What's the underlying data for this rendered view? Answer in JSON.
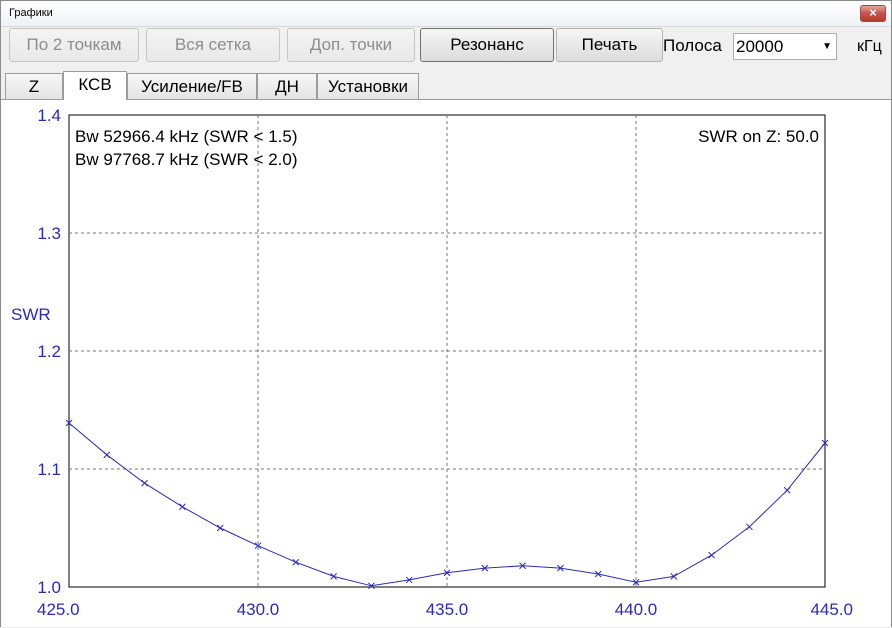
{
  "window": {
    "title": "Графики",
    "close_icon": "×"
  },
  "toolbar": {
    "by2points": "По 2 точкам",
    "whole_grid": "Вся сетка",
    "extra_points": "Доп. точки",
    "resonance": "Резонанс",
    "print": "Печать",
    "band_label": "Полоса",
    "band_value": "20000",
    "band_unit": "кГц"
  },
  "tabs": [
    "Z",
    "КСВ",
    "Усиление/FB",
    "ДН",
    "Установки"
  ],
  "chart_data": {
    "type": "line",
    "ylabel": "SWR",
    "xlim": [
      425.0,
      445.0
    ],
    "ylim": [
      1.0,
      1.4
    ],
    "xticks": [
      "425.0",
      "430.0",
      "435.0",
      "440.0",
      "445.0"
    ],
    "yticks": [
      "1.0",
      "1.1",
      "1.2",
      "1.3",
      "1.4"
    ],
    "grid": true,
    "annotations": {
      "bw1": "Bw 52966.4 kHz (SWR < 1.5)",
      "bw2": "Bw 97768.7 kHz (SWR < 2.0)",
      "z": "SWR on Z: 50.0"
    },
    "color": "#2b2bbb",
    "series": [
      {
        "x": [
          425,
          426,
          427,
          428,
          429,
          430,
          431,
          432,
          433,
          434,
          435,
          436,
          437,
          438,
          439,
          440,
          441,
          442,
          443,
          444,
          445
        ],
        "y": [
          1.139,
          1.112,
          1.088,
          1.068,
          1.05,
          1.035,
          1.021,
          1.009,
          1.001,
          1.006,
          1.012,
          1.016,
          1.018,
          1.016,
          1.011,
          1.004,
          1.009,
          1.027,
          1.051,
          1.082,
          1.122
        ]
      }
    ]
  }
}
